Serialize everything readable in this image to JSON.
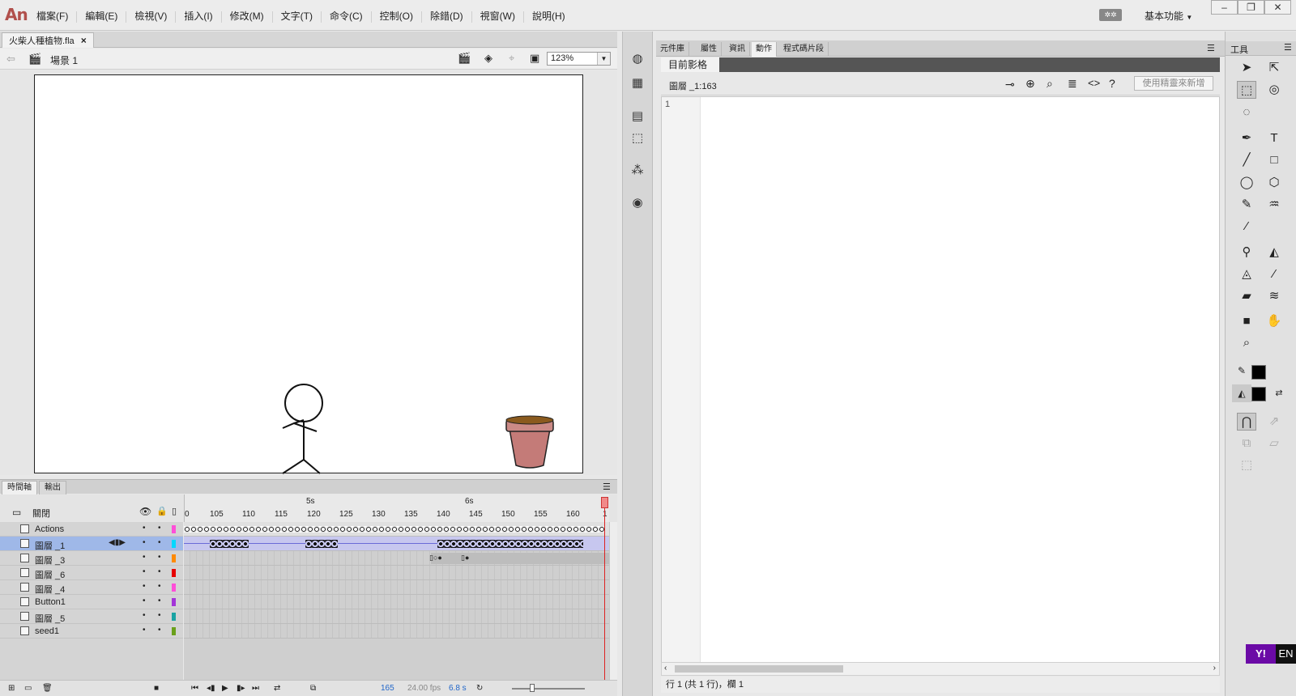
{
  "app": {
    "logo": "An"
  },
  "menu": [
    "檔案(F)",
    "編輯(E)",
    "檢視(V)",
    "插入(I)",
    "修改(M)",
    "文字(T)",
    "命令(C)",
    "控制(O)",
    "除錯(D)",
    "視窗(W)",
    "說明(H)"
  ],
  "header": {
    "sync_label": "✲✲",
    "workspace": "基本功能"
  },
  "document": {
    "tab_title": "火柴人種植物.fla",
    "scene": "場景 1",
    "zoom": "123%"
  },
  "timeline": {
    "tabs": [
      "時間軸",
      "輸出"
    ],
    "header_label": "關閉",
    "second_marks": [
      "5s",
      "6s"
    ],
    "ruler": [
      "0",
      "105",
      "110",
      "115",
      "120",
      "125",
      "130",
      "135",
      "140",
      "145",
      "150",
      "155",
      "160",
      "1"
    ],
    "layers": [
      "Actions",
      "圖層 _1",
      "圖層 _3",
      "圖層 _6",
      "圖層 _4",
      "Button1",
      "圖層 _5",
      "seed1"
    ],
    "layer_colors": [
      "#ff4fd8",
      "#00d8ff",
      "#ff8a00",
      "#e60000",
      "#ff4fd8",
      "#a335d8",
      "#1aa3a3",
      "#6aa01a"
    ],
    "footer": {
      "frame": "165",
      "fps": "24.00 fps",
      "time": "6.8 s"
    }
  },
  "actions_panel": {
    "tabs": [
      "元件庫",
      "屬性",
      "資訊",
      "動作",
      "程式碼片段"
    ],
    "current_tab": "目前影格",
    "target": "圖層 _1:163",
    "wizard_button": "使用精靈來新增",
    "line_number": "1",
    "status": "行 1 (共 1 行)，欄 1"
  },
  "tools_panel": {
    "title": "工具"
  },
  "ime": {
    "yahoo": "Y!",
    "lang": "EN"
  }
}
